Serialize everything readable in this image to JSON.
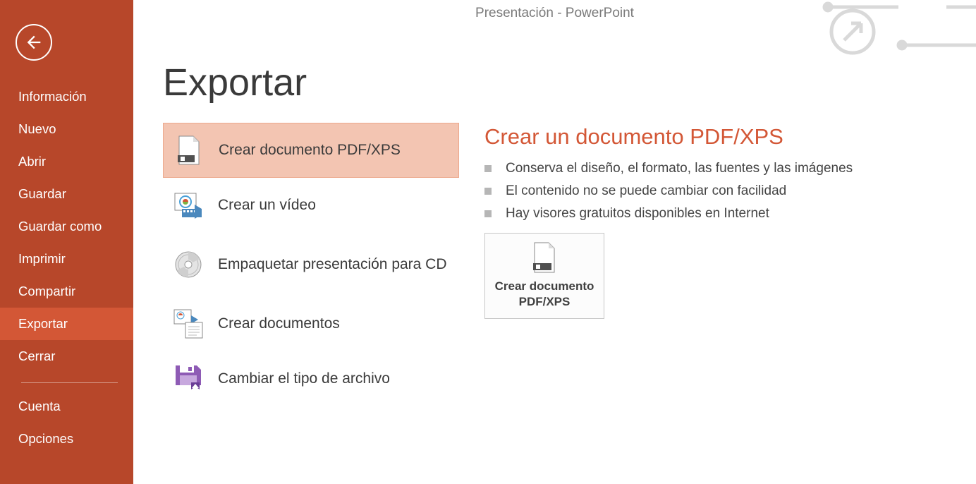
{
  "window_title": "Presentación - PowerPoint",
  "page_title": "Exportar",
  "sidebar": {
    "items": [
      {
        "label": "Información"
      },
      {
        "label": "Nuevo"
      },
      {
        "label": "Abrir"
      },
      {
        "label": "Guardar"
      },
      {
        "label": "Guardar como"
      },
      {
        "label": "Imprimir"
      },
      {
        "label": "Compartir"
      },
      {
        "label": "Exportar"
      },
      {
        "label": "Cerrar"
      }
    ],
    "footer_items": [
      {
        "label": "Cuenta"
      },
      {
        "label": "Opciones"
      }
    ]
  },
  "export_options": [
    {
      "label": "Crear documento PDF/XPS",
      "icon": "pdf"
    },
    {
      "label": "Crear un vídeo",
      "icon": "video"
    },
    {
      "label": "Empaquetar presentación para CD",
      "icon": "cd"
    },
    {
      "label": "Crear documentos",
      "icon": "docs"
    },
    {
      "label": "Cambiar el tipo de archivo",
      "icon": "saveas"
    }
  ],
  "detail": {
    "heading": "Crear un documento PDF/XPS",
    "bullets": [
      "Conserva el diseño, el formato, las fuentes y las imágenes",
      "El contenido no se puede cambiar con facilidad",
      "Hay visores gratuitos disponibles en Internet"
    ],
    "button_label": "Crear documento PDF/XPS"
  }
}
